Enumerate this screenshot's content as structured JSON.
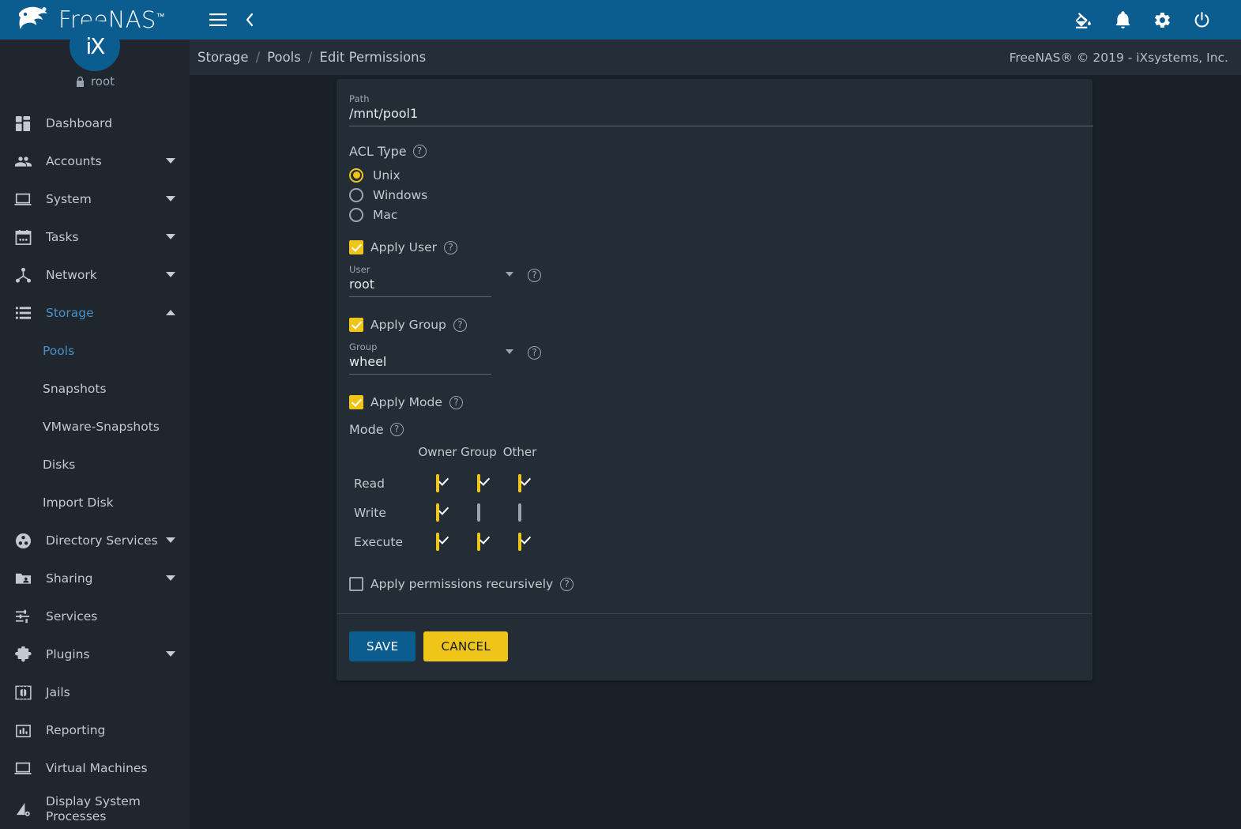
{
  "brand": {
    "name": "FreeNAS",
    "tm": "™",
    "avatar_initials": "iX"
  },
  "user": {
    "name": "root",
    "lock_icon": "lock-icon"
  },
  "topbar": {
    "menu_icon": "hamburger-menu-icon",
    "back_icon": "chevron-left-icon",
    "theme_icon": "paint-fill-icon",
    "alerts_icon": "bell-icon",
    "settings_icon": "gear-icon",
    "power_icon": "power-icon"
  },
  "breadcrumb": {
    "items": [
      "Storage",
      "Pools",
      "Edit Permissions"
    ],
    "separator": "/",
    "copyright": "FreeNAS® © 2019 - iXsystems, Inc."
  },
  "sidebar": {
    "items": [
      {
        "label": "Dashboard",
        "icon": "dashboard-icon",
        "expandable": false,
        "active": false
      },
      {
        "label": "Accounts",
        "icon": "people-icon",
        "expandable": true,
        "active": false
      },
      {
        "label": "System",
        "icon": "monitor-icon",
        "expandable": true,
        "active": false
      },
      {
        "label": "Tasks",
        "icon": "calendar-icon",
        "expandable": true,
        "active": false
      },
      {
        "label": "Network",
        "icon": "network-icon",
        "expandable": true,
        "active": false
      },
      {
        "label": "Storage",
        "icon": "storage-icon",
        "expandable": true,
        "active": true
      },
      {
        "label": "Directory Services",
        "icon": "directory-services-icon",
        "expandable": true,
        "active": false
      },
      {
        "label": "Sharing",
        "icon": "share-folder-icon",
        "expandable": true,
        "active": false
      },
      {
        "label": "Services",
        "icon": "sliders-icon",
        "expandable": false,
        "active": false
      },
      {
        "label": "Plugins",
        "icon": "puzzle-piece-icon",
        "expandable": true,
        "active": false
      },
      {
        "label": "Jails",
        "icon": "jail-icon",
        "expandable": false,
        "active": false
      },
      {
        "label": "Reporting",
        "icon": "bar-chart-icon",
        "expandable": false,
        "active": false
      },
      {
        "label": "Virtual Machines",
        "icon": "monitor-icon",
        "expandable": false,
        "active": false
      },
      {
        "label": "Display System Processes",
        "icon": "processes-icon",
        "expandable": false,
        "active": false
      }
    ],
    "storage_children": [
      {
        "label": "Pools",
        "active": true
      },
      {
        "label": "Snapshots",
        "active": false
      },
      {
        "label": "VMware-Snapshots",
        "active": false
      },
      {
        "label": "Disks",
        "active": false
      },
      {
        "label": "Import Disk",
        "active": false
      }
    ]
  },
  "form": {
    "path": {
      "label": "Path",
      "value": "/mnt/pool1"
    },
    "acl_type": {
      "label": "ACL Type",
      "help": "?",
      "options": [
        {
          "label": "Unix",
          "selected": true
        },
        {
          "label": "Windows",
          "selected": false
        },
        {
          "label": "Mac",
          "selected": false
        }
      ]
    },
    "apply_user": {
      "label": "Apply User",
      "checked": true
    },
    "user": {
      "label": "User",
      "value": "root"
    },
    "apply_group": {
      "label": "Apply Group",
      "checked": true
    },
    "group": {
      "label": "Group",
      "value": "wheel"
    },
    "apply_mode": {
      "label": "Apply Mode",
      "checked": true
    },
    "mode": {
      "label": "Mode",
      "columns": [
        "Owner",
        "Group",
        "Other"
      ],
      "rows": [
        {
          "label": "Read",
          "owner": true,
          "group": true,
          "other": true
        },
        {
          "label": "Write",
          "owner": true,
          "group": false,
          "other": false
        },
        {
          "label": "Execute",
          "owner": true,
          "group": true,
          "other": true
        }
      ]
    },
    "recursive": {
      "label": "Apply permissions recursively",
      "checked": false
    },
    "buttons": {
      "save": "SAVE",
      "cancel": "CANCEL"
    },
    "help_glyph": "?"
  },
  "colors": {
    "header_blue": "#0b5d8f",
    "accent_yellow": "#f0c51a",
    "page_bg": "#1a2027",
    "card_bg": "#242d36",
    "sidebar_bg": "#1f262e",
    "breadcrumb_bg": "#252e38",
    "active_link": "#4a90c4"
  }
}
